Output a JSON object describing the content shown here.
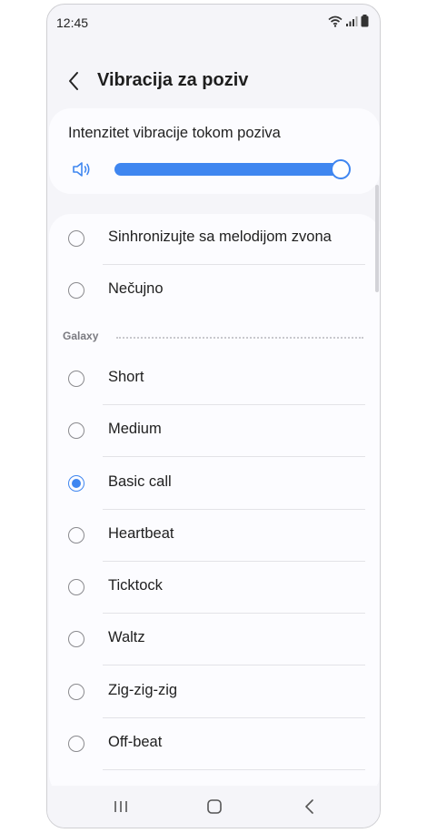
{
  "status_bar": {
    "time": "12:45"
  },
  "header": {
    "title": "Vibracija za poziv"
  },
  "intensity": {
    "label": "Intenzitet vibracije tokom poziva",
    "level_percent": 100
  },
  "patterns": {
    "top_options": [
      {
        "label": "Sinhronizujte sa melodijom zvona",
        "selected": false
      },
      {
        "label": "Nečujno",
        "selected": false
      }
    ],
    "section_label": "Galaxy",
    "galaxy_options": [
      {
        "label": "Short",
        "selected": false
      },
      {
        "label": "Medium",
        "selected": false
      },
      {
        "label": "Basic call",
        "selected": true
      },
      {
        "label": "Heartbeat",
        "selected": false
      },
      {
        "label": "Ticktock",
        "selected": false
      },
      {
        "label": "Waltz",
        "selected": false
      },
      {
        "label": "Zig-zig-zig",
        "selected": false
      },
      {
        "label": "Off-beat",
        "selected": false
      }
    ]
  },
  "colors": {
    "accent": "#3f86f0",
    "background": "#f5f5f9",
    "card": "#fcfcff"
  },
  "icons": [
    "wifi-icon",
    "signal-icon",
    "battery-icon",
    "back-arrow-icon",
    "volume-icon",
    "recents-icon",
    "home-icon",
    "back-nav-icon"
  ]
}
